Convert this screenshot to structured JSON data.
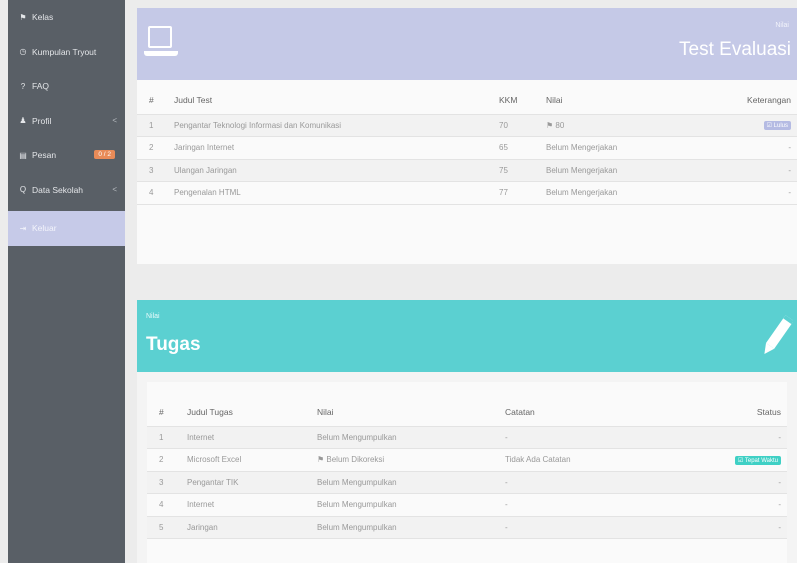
{
  "sidebar": {
    "items": [
      {
        "icon": "graduation-cap-icon",
        "glyph": "⚑",
        "label": "Kelas"
      },
      {
        "icon": "clock-icon",
        "glyph": "◷",
        "label": "Kumpulan Tryout"
      },
      {
        "icon": "question-icon",
        "glyph": "?",
        "label": "FAQ"
      },
      {
        "icon": "user-icon",
        "glyph": "♟",
        "label": "Profil",
        "chevron": "<"
      },
      {
        "icon": "envelope-icon",
        "glyph": "▤",
        "label": "Pesan",
        "badge": "0 / 2"
      },
      {
        "icon": "search-icon",
        "glyph": "Q",
        "label": "Data Sekolah",
        "chevron": "<"
      },
      {
        "icon": "logout-icon",
        "glyph": "⇥",
        "label": "Keluar",
        "active": true
      }
    ]
  },
  "test_panel": {
    "lead": "Nilai",
    "title": "Test Evaluasi",
    "headers": [
      "#",
      "Judul Test",
      "KKM",
      "Nilai",
      "Keterangan"
    ],
    "rows": [
      {
        "no": "1",
        "judul": "Pengantar Teknologi Informasi dan Komunikasi",
        "kkm": "70",
        "nilai": "⚑ 80",
        "ket": "☑ Lulus"
      },
      {
        "no": "2",
        "judul": "Jaringan Internet",
        "kkm": "65",
        "nilai": "Belum Mengerjakan",
        "ket": "-"
      },
      {
        "no": "3",
        "judul": "Ulangan Jaringan",
        "kkm": "75",
        "nilai": "Belum Mengerjakan",
        "ket": "-"
      },
      {
        "no": "4",
        "judul": "Pengenalan HTML",
        "kkm": "77",
        "nilai": "Belum Mengerjakan",
        "ket": "-"
      }
    ]
  },
  "tugas_panel": {
    "lead": "Nilai",
    "title": "Tugas",
    "headers": [
      "#",
      "Judul Tugas",
      "Nilai",
      "Catatan",
      "Status"
    ],
    "rows": [
      {
        "no": "1",
        "judul": "Internet",
        "nilai": "Belum Mengumpulkan",
        "catatan": "-",
        "status": "-"
      },
      {
        "no": "2",
        "judul": "Microsoft Excel",
        "nilai": "⚑ Belum Dikoreksi",
        "catatan": "Tidak Ada Catatan",
        "status": "☑ Tepat Waktu"
      },
      {
        "no": "3",
        "judul": "Pengantar TIK",
        "nilai": "Belum Mengumpulkan",
        "catatan": "-",
        "status": "-"
      },
      {
        "no": "4",
        "judul": "Internet",
        "nilai": "Belum Mengumpulkan",
        "catatan": "-",
        "status": "-"
      },
      {
        "no": "5",
        "judul": "Jaringan",
        "nilai": "Belum Mengumpulkan",
        "catatan": "-",
        "status": "-"
      }
    ]
  },
  "colors": {
    "sidebar_bg": "#595f66",
    "hero_test": "#c5c9e7",
    "hero_tugas": "#5bd0d1",
    "badge": "#e98b58"
  }
}
